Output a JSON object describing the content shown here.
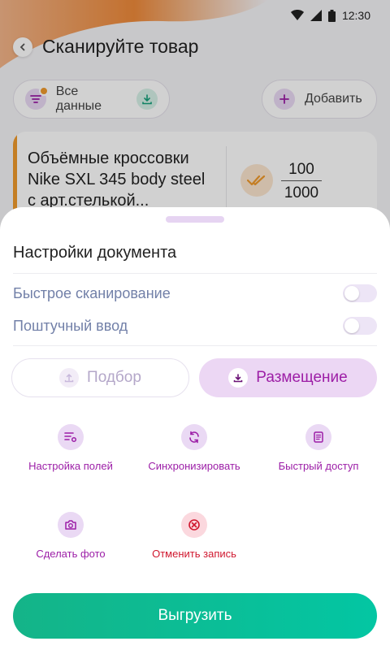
{
  "status": {
    "time": "12:30"
  },
  "header": {
    "title": "Сканируйте товар"
  },
  "filters": {
    "all_label": "Все данные",
    "add_label": "Добавить"
  },
  "product": {
    "title": "Объёмные кроссовки Nike SXL 345 body steel с арт.стелькой...",
    "qty_done": "100",
    "qty_total": "1000"
  },
  "sheet": {
    "title": "Настройки документа",
    "toggles": [
      {
        "label": "Быстрое сканирование",
        "on": false
      },
      {
        "label": "Поштучный ввод",
        "on": false
      }
    ],
    "segments": {
      "podbor": "Подбор",
      "razmeshchenie": "Размещение",
      "selected": "Размещение"
    },
    "actions": [
      {
        "label": "Настройка полей",
        "icon": "fields-settings-icon"
      },
      {
        "label": "Синхронизировать",
        "icon": "sync-icon"
      },
      {
        "label": "Быстрый доступ",
        "icon": "document-icon"
      },
      {
        "label": "Сделать фото",
        "icon": "camera-icon"
      },
      {
        "label": "Отменить запись",
        "icon": "cancel-icon"
      }
    ],
    "export_label": "Выгрузить"
  },
  "colors": {
    "accent": "#9c1ea7",
    "danger": "#d0182f",
    "brand_orange": "#f09a2c",
    "primary_green": "#14b488"
  }
}
